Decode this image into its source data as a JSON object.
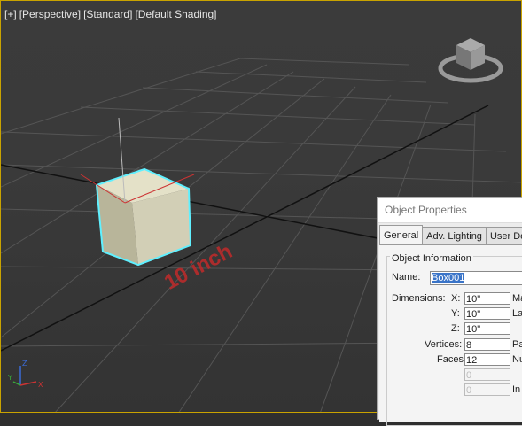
{
  "viewport": {
    "label_parts": [
      "[+]",
      "[Perspective]",
      "[Standard]",
      "[Default Shading]"
    ],
    "measurement": "10 inch",
    "axis_labels": {
      "z": "Z",
      "y": "Y",
      "x": "X"
    },
    "viewcube_face": "TOP"
  },
  "dialog": {
    "title": "Object Properties",
    "tabs": [
      "General",
      "Adv. Lighting",
      "User Der"
    ],
    "group_title": "Object Information",
    "name_label": "Name:",
    "name_value": "Box001",
    "dimensions_label": "Dimensions:",
    "x_label": "X:",
    "x_value": "10\"",
    "x_side": "Ma",
    "y_label": "Y:",
    "y_value": "10\"",
    "y_side": "La",
    "z_label": "Z:",
    "z_value": "10\"",
    "vertices_label": "Vertices:",
    "vertices_value": "8",
    "vertices_side": "Pa",
    "faces_label": "Faces:",
    "faces_value": "12",
    "faces_side": "Nu",
    "extra1_value": "0",
    "extra2_value": "0",
    "extra2_side": "In"
  },
  "colors": {
    "accent_border": "#c9a300",
    "selection": "#3a74c8",
    "measure": "#b92b2b",
    "cube_outline": "#5ff0ff"
  }
}
